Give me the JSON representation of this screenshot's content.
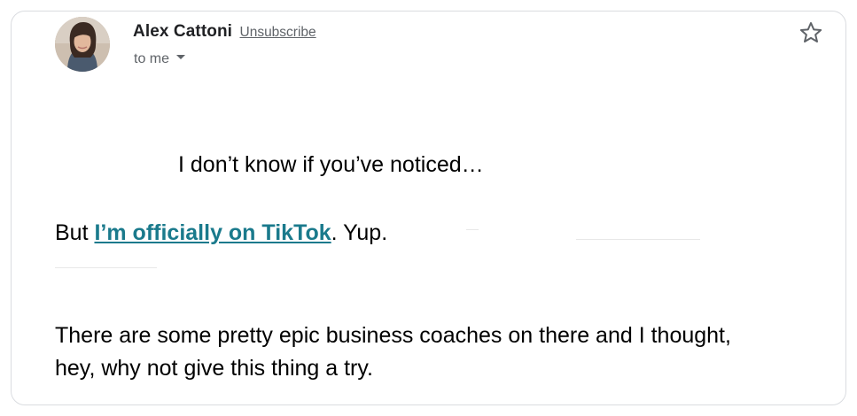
{
  "sender": {
    "name": "Alex Cattoni",
    "unsubscribe_label": "Unsubscribe",
    "recipient_label": "to me"
  },
  "message": {
    "line1": "I don’t know if you’ve noticed…",
    "line2_before": "But ",
    "line2_link": "I’m officially on TikTok",
    "line2_after": ". Yup.",
    "line3a": "There are some pretty epic business coaches on there and I thought,",
    "line3b": "hey, why not give this thing a try."
  },
  "colors": {
    "link": "#1a7a8c",
    "secondary_text": "#5f6368",
    "border": "#dadce0"
  },
  "icons": {
    "star": "star-outline-icon",
    "recipient_caret": "caret-down-icon"
  }
}
